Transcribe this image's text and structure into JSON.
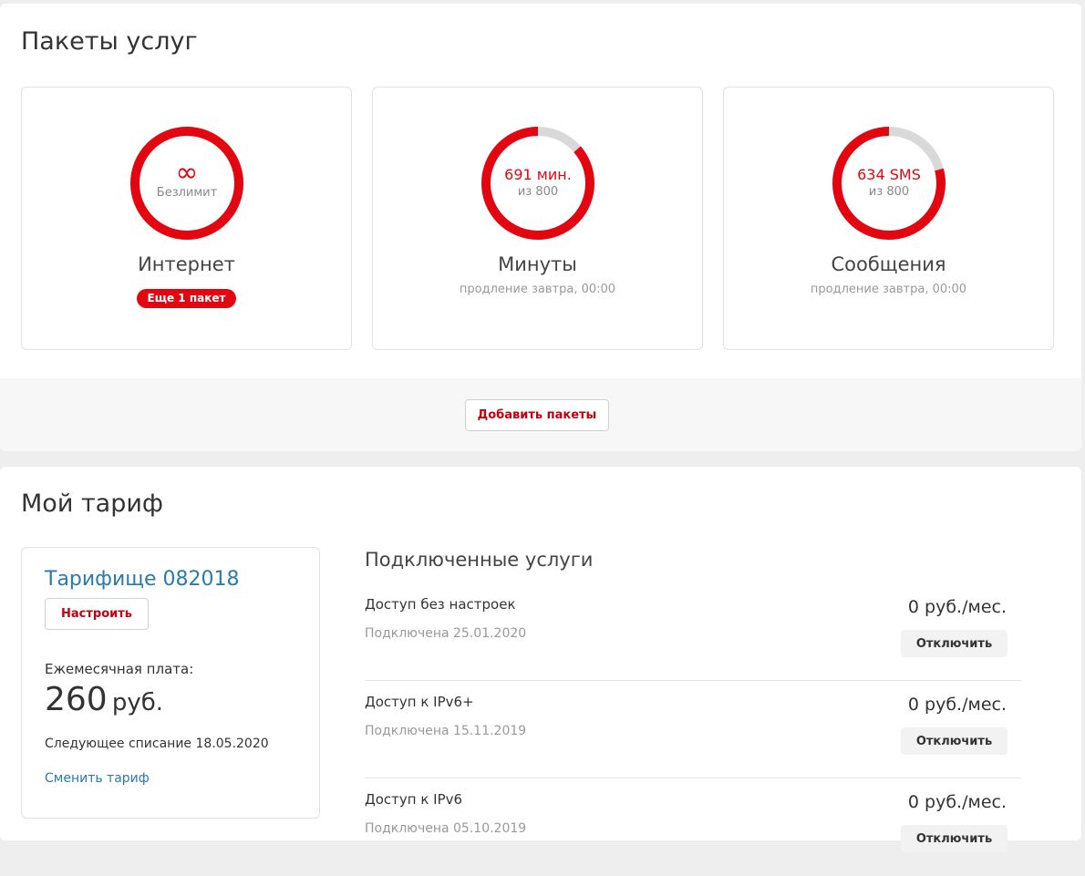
{
  "packages": {
    "title": "Пакеты услуг",
    "add_button_label": "Добавить пакеты",
    "cards": [
      {
        "id": "internet",
        "name": "Интернет",
        "center_icon": "infinity-icon",
        "center_icon_glyph": "∞",
        "center_sub": "Безлимит",
        "remaining_fraction": 1.0,
        "badge": "Еще 1 пакет"
      },
      {
        "id": "minutes",
        "name": "Минуты",
        "center_value": "691 мин.",
        "center_sub": "из 800",
        "remaining": 691,
        "total": 800,
        "note": "продление завтра, 00:00"
      },
      {
        "id": "sms",
        "name": "Сообщения",
        "center_value": "634 SMS",
        "center_sub": "из 800",
        "remaining": 634,
        "total": 800,
        "note": "продление завтра, 00:00"
      }
    ]
  },
  "tariff": {
    "title": "Мой тариф",
    "name": "Тарифище 082018",
    "configure_label": "Настроить",
    "monthly_label": "Ежемесячная плата:",
    "monthly_amount": "260",
    "monthly_currency": "руб.",
    "next_charge": "Следующее списание 18.05.2020",
    "change_link": "Сменить тариф"
  },
  "services": {
    "title": "Подключенные услуги",
    "items": [
      {
        "name": "Доступ без настроек",
        "date": "Подключена 25.01.2020",
        "price": "0 руб./мес.",
        "action": "Отключить"
      },
      {
        "name": "Доступ к IPv6+",
        "date": "Подключена 15.11.2019",
        "price": "0 руб./мес.",
        "action": "Отключить"
      },
      {
        "name": "Доступ к IPv6",
        "date": "Подключена 05.10.2019",
        "price": "0 руб./мес.",
        "action": "Отключить"
      }
    ]
  },
  "colors": {
    "accent": "#e30611",
    "ring_track": "#d9d9d9",
    "link": "#2b7aa8"
  }
}
